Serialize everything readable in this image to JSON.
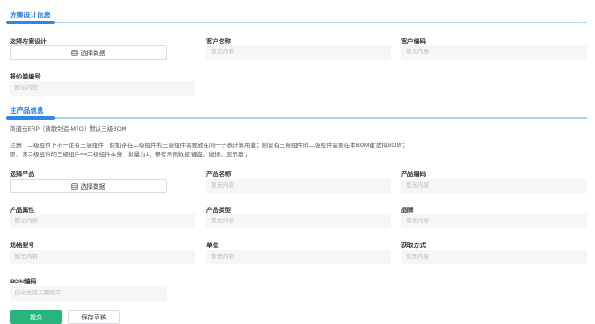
{
  "sections": {
    "scheme": {
      "title": "方案设计信息"
    },
    "product": {
      "title": "主产品信息"
    }
  },
  "scheme_form": {
    "select_scheme_label": "选择方案设计",
    "select_data_label": "选择数据",
    "customer_name_label": "客户名称",
    "customer_name_value": "暂无内容",
    "customer_code_label": "客户编码",
    "customer_code_value": "暂无内容",
    "quote_no_label": "报价单编号",
    "quote_no_value": "暂无内容"
  },
  "notes": {
    "line1": "简道云ERP（离散制造-MTO）默认三级BOM",
    "line2": "注意：二级组件下不一定有三级组件，假如存在二级组件和三级组件需要放在同一子表计算用量；则设有三级组件的二级组件需要在本BOM建'虚拟BOM'；",
    "line3": "即：该二级组件的三级组件==二级组件本身，数量为1；参考示例数据'键盘、鼠标、显示器'；"
  },
  "product_form": {
    "select_product_label": "选择产品",
    "select_data_label": "选择数据",
    "product_name_label": "产品名称",
    "product_name_value": "暂无内容",
    "product_code_label": "产品编码",
    "product_code_value": "暂无内容",
    "product_attr_label": "产品属性",
    "product_attr_value": "暂无内容",
    "product_type_label": "产品类型",
    "product_type_value": "暂无内容",
    "brand_label": "品牌",
    "brand_value": "暂无内容",
    "spec_label": "规格型号",
    "spec_value": "暂无内容",
    "unit_label": "单位",
    "unit_value": "暂无内容",
    "acquire_label": "获取方式",
    "acquire_value": "暂无内容",
    "bom_code_label": "BOM编码",
    "bom_code_value": "自动生成无需填写"
  },
  "actions": {
    "submit_label": "提交",
    "save_draft_label": "保存草稿"
  },
  "colors": {
    "accent": "#2f86ea",
    "primary_button": "#29b47e"
  }
}
